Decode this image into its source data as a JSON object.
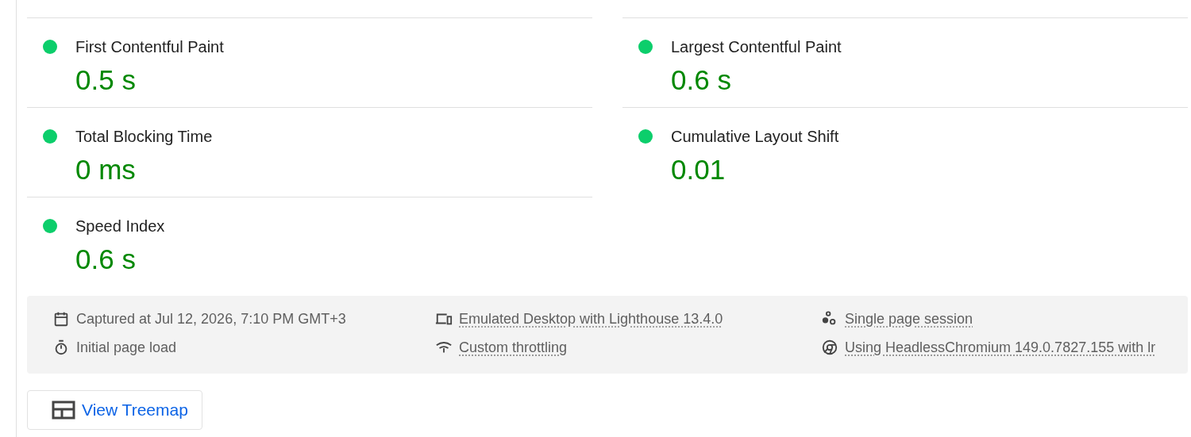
{
  "metrics": [
    {
      "title": "First Contentful Paint",
      "value": "0.5 s",
      "color": "#0cce6b"
    },
    {
      "title": "Largest Contentful Paint",
      "value": "0.6 s",
      "color": "#0cce6b"
    },
    {
      "title": "Total Blocking Time",
      "value": "0 ms",
      "color": "#0cce6b"
    },
    {
      "title": "Cumulative Layout Shift",
      "value": "0.01",
      "color": "#0cce6b"
    },
    {
      "title": "Speed Index",
      "value": "0.6 s",
      "color": "#0cce6b"
    }
  ],
  "runtime_info": [
    {
      "kind": "calendar",
      "text": "Captured at Jul 12, 2026, 7:10 PM GMT+3",
      "linked": false
    },
    {
      "kind": "devices",
      "text": "Emulated Desktop with Lighthouse 13.4.0",
      "linked": true
    },
    {
      "kind": "dots",
      "text": "Single page session",
      "linked": true
    },
    {
      "kind": "stopwatch",
      "text": "Initial page load",
      "linked": false
    },
    {
      "kind": "signal",
      "text": "Custom throttling",
      "linked": true
    },
    {
      "kind": "chrome",
      "text": "Using HeadlessChromium 149.0.7827.155 with lr",
      "linked": true
    }
  ],
  "treemap_button": {
    "label": "View Treemap"
  }
}
